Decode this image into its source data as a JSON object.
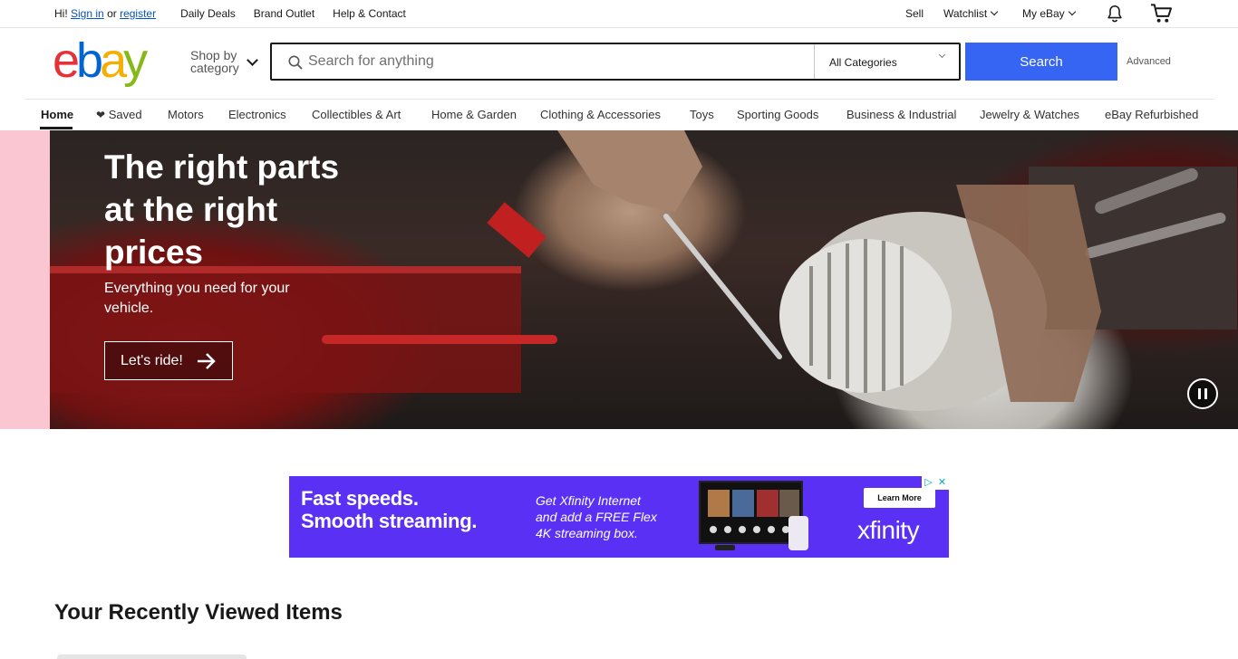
{
  "topbar": {
    "greeting": "Hi!",
    "sign_in": "Sign in",
    "or": "or",
    "register": "register",
    "links": [
      "Daily Deals",
      "Brand Outlet",
      "Help & Contact"
    ],
    "sell": "Sell",
    "watchlist": "Watchlist",
    "my_ebay": "My eBay",
    "icons": [
      "bell-icon",
      "cart-icon"
    ]
  },
  "header": {
    "logo": {
      "e": "e",
      "b": "b",
      "a": "a",
      "y": "y"
    },
    "shop_by_line1": "Shop by",
    "shop_by_line2": "category",
    "search_placeholder": "Search for anything",
    "category_selected": "All Categories",
    "search_button": "Search",
    "advanced": "Advanced",
    "colors": {
      "search_button": "#3665f3",
      "logo_e": "#e53238",
      "logo_b": "#0064d2",
      "logo_a": "#f5af02",
      "logo_y": "#86b817"
    }
  },
  "nav": {
    "items": [
      "Home",
      "Saved",
      "Motors",
      "Electronics",
      "Collectibles & Art",
      "Home & Garden",
      "Clothing & Accessories",
      "Toys",
      "Sporting Goods",
      "Business & Industrial",
      "Jewelry & Watches",
      "eBay Refurbished"
    ],
    "active": "Home"
  },
  "hero": {
    "title": "The right parts at the right prices",
    "subtitle": "Everything you need for your vehicle.",
    "cta": "Let's ride!",
    "pause_icon": "pause-icon"
  },
  "ad": {
    "headline_1": "Fast speeds.",
    "headline_2": "Smooth streaming.",
    "copy_1": "Get Xfinity Internet",
    "copy_2": "and add a FREE Flex",
    "copy_3": "4K streaming box.",
    "learn_more": "Learn More",
    "brand": "xfinity",
    "background": "#5a31f4"
  },
  "recently_viewed": {
    "title": "Your Recently Viewed Items"
  }
}
